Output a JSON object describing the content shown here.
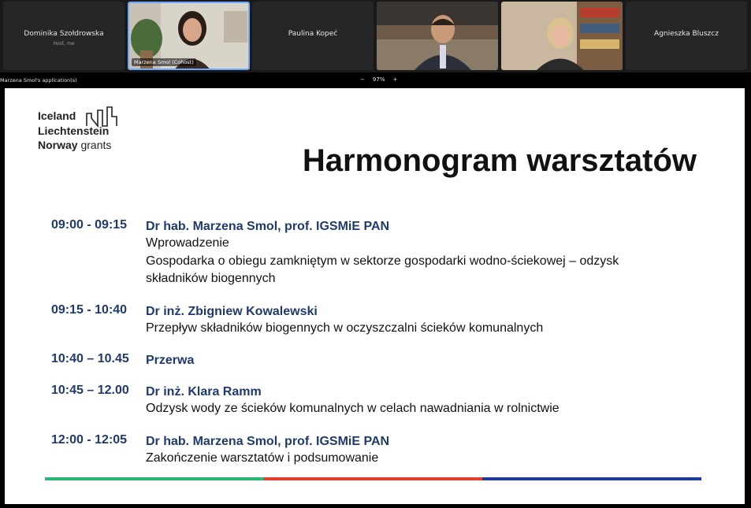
{
  "participants": [
    {
      "name": "Dominika Szołdrowska",
      "sub": "Host, me",
      "type": "name"
    },
    {
      "label": "Marzena Smol (Cohost)",
      "type": "video",
      "active": true
    },
    {
      "name": "Paulina Kopeć",
      "type": "name"
    },
    {
      "type": "video"
    },
    {
      "type": "video"
    },
    {
      "name": "Agnieszka Bluszcz",
      "type": "name"
    }
  ],
  "share_bar": {
    "title": "Marzena Smol's application(s)",
    "zoom_minus": "−",
    "zoom_level": "97%",
    "zoom_plus": "+"
  },
  "slide": {
    "logo": {
      "line1": "Iceland",
      "line2": "Liechtenstein",
      "line3a": "Norway",
      "line3b": "grants"
    },
    "title": "Harmonogram warsztatów",
    "agenda": [
      {
        "time": "09:00 - 09:15",
        "speaker": "Dr hab. Marzena Smol, prof. IGSMiE PAN",
        "lines": [
          "Wprowadzenie",
          "Gospodarka o obiegu zamkniętym w sektorze gospodarki wodno-ściekowej – odzysk",
          "składników biogennych"
        ]
      },
      {
        "time": "09:15 - 10:40",
        "speaker": "Dr inż. Zbigniew Kowalewski",
        "lines": [
          "Przepływ składników biogennych w oczyszczalni ścieków komunalnych"
        ]
      },
      {
        "time": "10:40 – 10.45",
        "speaker": "Przerwa",
        "lines": []
      },
      {
        "time": "10:45 – 12.00",
        "speaker": "Dr inż. Klara Ramm",
        "lines": [
          "Odzysk wody ze ścieków komunalnych w celach nawadniania w rolnictwie"
        ]
      },
      {
        "time": "12:00 - 12:05",
        "speaker": "Dr hab. Marzena Smol, prof. IGSMiE PAN",
        "lines": [
          "Zakończenie warsztatów i podsumowanie"
        ]
      }
    ],
    "stripe_colors": [
      "#2bb673",
      "#e63a2c",
      "#1d3c96"
    ]
  }
}
